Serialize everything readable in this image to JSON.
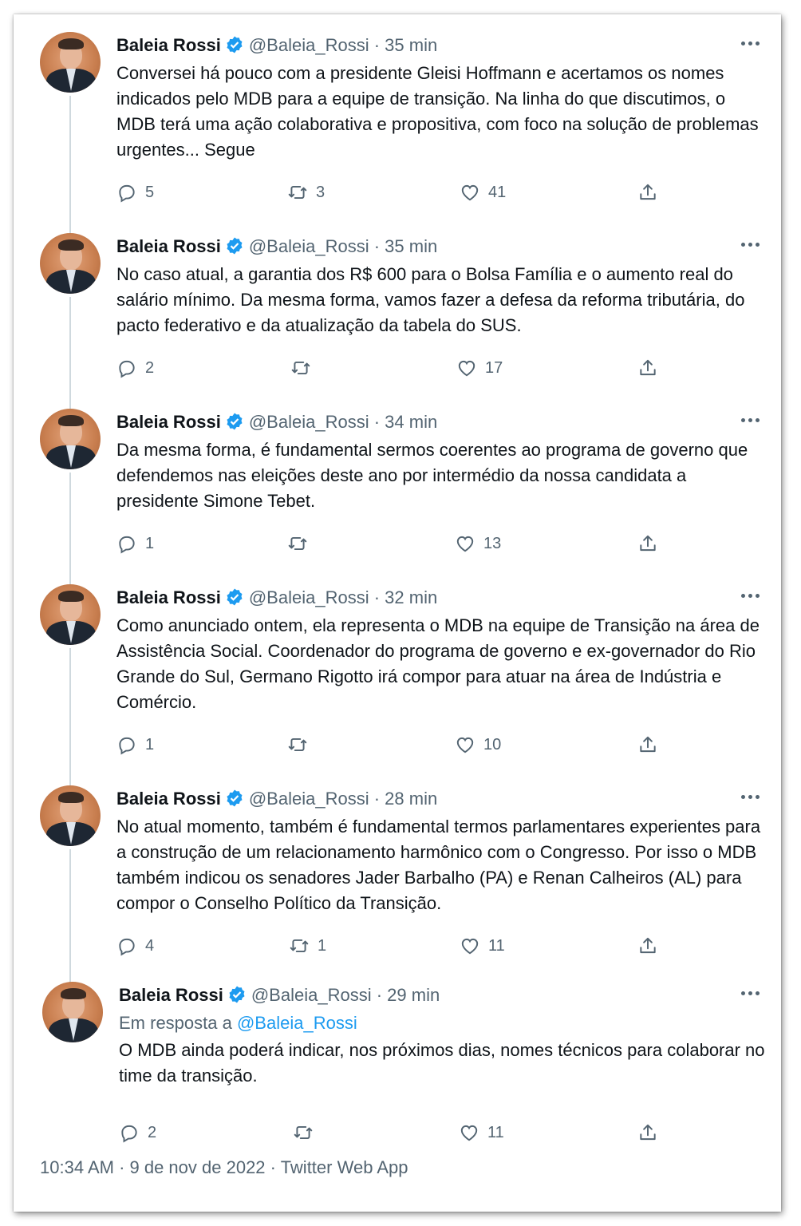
{
  "tweets": [
    {
      "name": "Baleia Rossi",
      "handle": "@Baleia_Rossi",
      "separator": "·",
      "time": "35 min",
      "text": "Conversei há pouco com a presidente Gleisi Hoffmann e acertamos os nomes indicados pelo MDB para a equipe de transição. Na linha do que discutimos, o MDB terá uma ação colaborativa e propositiva, com foco na solução de problemas urgentes... Segue",
      "replies": "5",
      "retweets": "3",
      "likes": "41"
    },
    {
      "name": "Baleia Rossi",
      "handle": "@Baleia_Rossi",
      "separator": "·",
      "time": "35 min",
      "text": "No caso atual,  a garantia dos R$ 600 para o Bolsa Família e o aumento real do salário mínimo. Da mesma forma, vamos fazer a defesa da reforma tributária, do pacto federativo e da atualização da tabela do SUS.",
      "replies": "2",
      "retweets": "",
      "likes": "17"
    },
    {
      "name": "Baleia Rossi",
      "handle": "@Baleia_Rossi",
      "separator": "·",
      "time": "34 min",
      "text": "Da mesma forma, é fundamental sermos coerentes ao programa de governo que defendemos nas eleições deste ano por intermédio da nossa candidata a presidente Simone Tebet.",
      "replies": "1",
      "retweets": "",
      "likes": "13"
    },
    {
      "name": "Baleia Rossi",
      "handle": "@Baleia_Rossi",
      "separator": "·",
      "time": "32 min",
      "text": "Como anunciado ontem, ela representa o MDB na equipe de Transição na área de Assistência Social. Coordenador do programa de governo e ex-governador do Rio Grande do Sul, Germano Rigotto irá compor para atuar na área de Indústria e Comércio.",
      "replies": "1",
      "retweets": "",
      "likes": "10"
    },
    {
      "name": "Baleia Rossi",
      "handle": "@Baleia_Rossi",
      "separator": "·",
      "time": "28 min",
      "text": "No atual momento, também é fundamental termos parlamentares experientes para a construção de um relacionamento harmônico com o Congresso. Por isso o MDB também indicou os senadores Jader Barbalho (PA) e Renan Calheiros (AL) para compor o Conselho Político da Transição.",
      "replies": "4",
      "retweets": "1",
      "likes": "11"
    },
    {
      "name": "Baleia Rossi",
      "handle": "@Baleia_Rossi",
      "separator": "·",
      "time": "29 min",
      "reply_prefix": "Em resposta a",
      "reply_handle": "@Baleia_Rossi",
      "text": "O MDB ainda poderá indicar, nos próximos dias, nomes técnicos para colaborar no time da transição.",
      "replies": "2",
      "retweets": "",
      "likes": "11"
    }
  ],
  "footer": "10:34 AM · 9 de nov de 2022 · Twitter Web App",
  "icons": {
    "verified": "verified-badge-icon",
    "reply": "reply-icon",
    "retweet": "retweet-icon",
    "like": "heart-icon",
    "share": "share-icon",
    "more": "more-icon"
  },
  "colors": {
    "verified": "#1d9bf0",
    "link": "#1d9bf0",
    "secondary_text": "#536471",
    "thread_line": "#cfd9de"
  }
}
